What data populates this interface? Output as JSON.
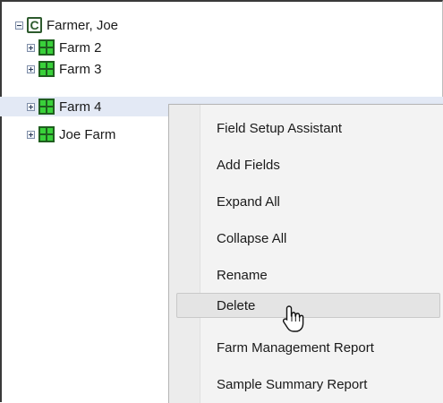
{
  "tree": {
    "client": {
      "label": "Farmer, Joe",
      "expanded": true
    },
    "farms": [
      {
        "label": "Farm 2",
        "selected": false
      },
      {
        "label": "Farm 3",
        "selected": false
      },
      {
        "label": "Farm 4",
        "selected": true
      },
      {
        "label": "Joe Farm",
        "selected": false
      }
    ]
  },
  "context_menu": {
    "items": [
      {
        "label": "Field Setup Assistant"
      },
      {
        "label": "Add Fields"
      },
      {
        "label": "Expand All"
      },
      {
        "label": "Collapse All"
      },
      {
        "label": "Rename"
      },
      {
        "label": "Delete",
        "hovered": true
      },
      {
        "label": "Farm Management Report"
      },
      {
        "label": "Sample Summary Report"
      }
    ]
  },
  "icons": {
    "client": "client-c-icon",
    "farm": "farm-grid-icon",
    "expand": "plus-box-icon",
    "collapse": "minus-box-icon",
    "cursor": "hand-pointer-icon"
  },
  "colors": {
    "selection": "#e3e9f5",
    "menu_bg": "#f3f3f3",
    "menu_hover": "#e4e4e4",
    "farm_icon_green": "#39d13a",
    "farm_icon_dark": "#1f5e1f"
  }
}
